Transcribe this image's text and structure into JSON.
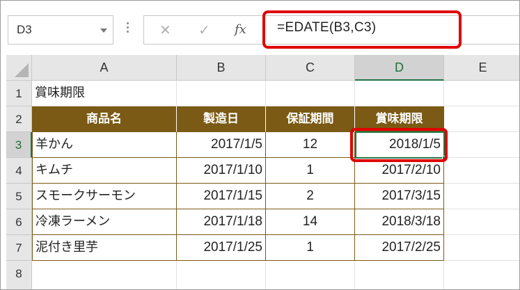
{
  "formula_bar": {
    "name_box": "D3",
    "cancel_icon": "close-icon",
    "enter_icon": "check-icon",
    "fx_label": "fx",
    "formula": "=EDATE(B3,C3)"
  },
  "columns": [
    "A",
    "B",
    "C",
    "D",
    "E"
  ],
  "rows": [
    "1",
    "2",
    "3",
    "4",
    "5",
    "6",
    "7",
    "8"
  ],
  "active_cell": {
    "column": "D",
    "row": "3"
  },
  "cells": {
    "a1": "賞味期限",
    "header": [
      "商品名",
      "製造日",
      "保証期間",
      "賞味期限"
    ],
    "data": [
      {
        "name": "羊かん",
        "made": "2017/1/5",
        "months": "12",
        "expiry": "2018/1/5"
      },
      {
        "name": "キムチ",
        "made": "2017/1/10",
        "months": "1",
        "expiry": "2017/2/10"
      },
      {
        "name": "スモークサーモン",
        "made": "2017/1/15",
        "months": "2",
        "expiry": "2017/3/15"
      },
      {
        "name": "冷凍ラーメン",
        "made": "2017/1/18",
        "months": "14",
        "expiry": "2018/3/18"
      },
      {
        "name": "泥付き里芋",
        "made": "2017/1/25",
        "months": "1",
        "expiry": "2017/2/25"
      }
    ]
  },
  "colors": {
    "header_fill": "#7a5a14",
    "highlight": "#e00000",
    "selection": "#217346"
  }
}
